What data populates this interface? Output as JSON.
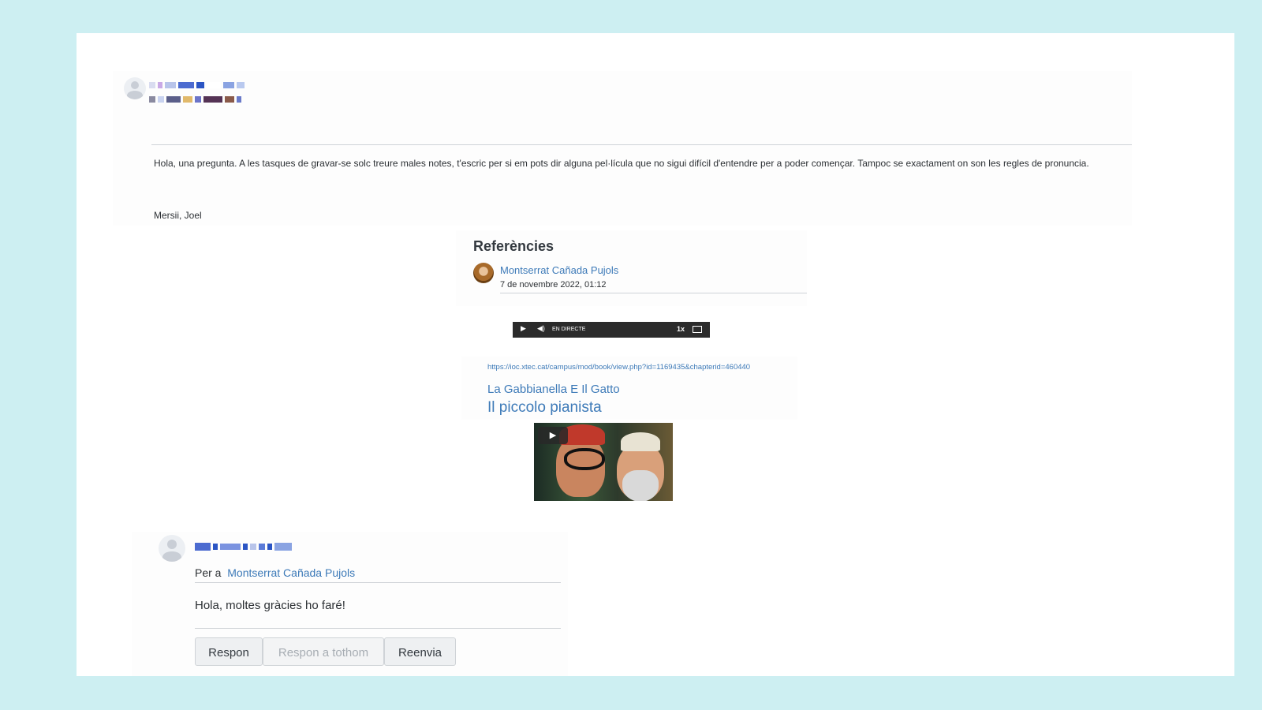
{
  "post": {
    "body": "Hola, una pregunta. A les tasques de gravar-se solc treure males notes, t'escric per si em pots dir alguna pel·lícula que no sigui difícil d'entendre per a poder començar. Tampoc se exactament on son les regles de pronuncia.",
    "signature": "Mersii, Joel"
  },
  "references": {
    "title": "Referències",
    "author": "Montserrat Cañada Pujols",
    "date": "7 de novembre 2022, 01:12"
  },
  "player": {
    "live_label": "EN DIRECTE",
    "speed": "1x"
  },
  "links": {
    "url": "https://ioc.xtec.cat/campus/mod/book/view.php?id=1169435&chapterid=460440",
    "title1": "La Gabbianella E Il Gatto",
    "title2": "Il piccolo pianista"
  },
  "reply": {
    "per_label": "Per a",
    "recipient": "Montserrat Cañada Pujols",
    "text": "Hola, moltes gràcies ho faré!",
    "buttons": {
      "reply": "Respon",
      "reply_all": "Respon a tothom",
      "forward": "Reenvia"
    }
  },
  "icons": [
    "user-avatar-icon",
    "play-icon",
    "volume-icon",
    "picture-in-picture-icon",
    "video-play-icon"
  ],
  "colors": {
    "background": "#cdeff2",
    "link": "#3d7ab8"
  }
}
